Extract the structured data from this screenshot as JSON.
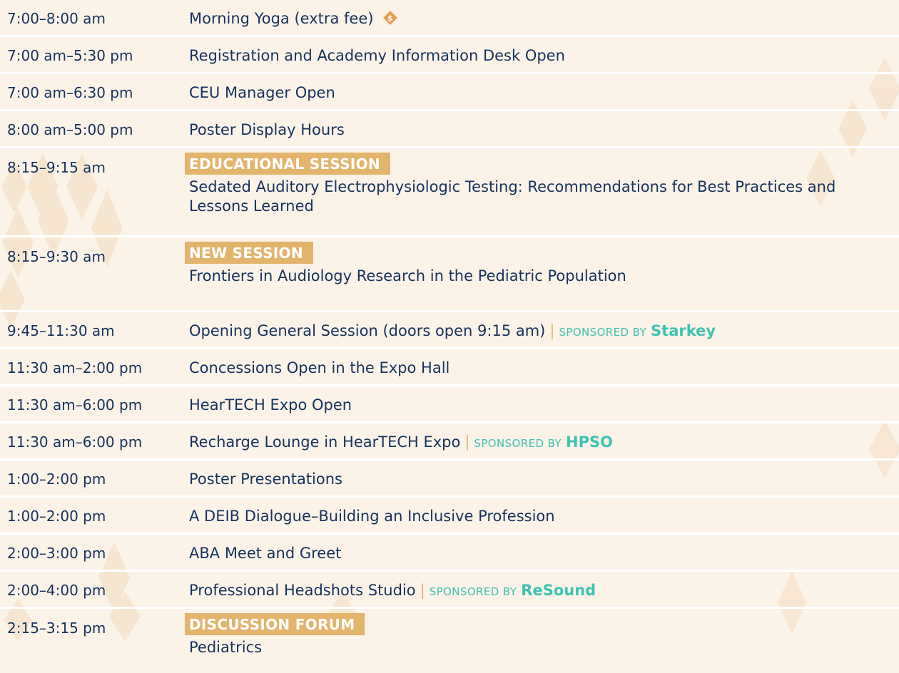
{
  "colors": {
    "background": "#fbf3e8",
    "text": "#16325c",
    "tag_background": "#e3b46c",
    "sponsor": "#3fc2b3",
    "divider": "#ffffff"
  },
  "icons": {
    "fee": "dollar-diamond-icon"
  },
  "rows": [
    {
      "time": "7:00–8:00 am",
      "title": "Morning Yoga (extra fee)"
    },
    {
      "time": "7:00 am–5:30 pm",
      "title": "Registration and Academy Information Desk Open"
    },
    {
      "time": "7:00 am–6:30 pm",
      "title": "CEU Manager Open"
    },
    {
      "time": "8:00 am–5:00 pm",
      "title": "Poster Display Hours"
    },
    {
      "time": "8:15–9:15 am",
      "tag": "EDUCATIONAL SESSION",
      "title": "Sedated Auditory Electrophysiologic Testing: Recommendations for Best Practices and Lessons Learned"
    },
    {
      "time": "8:15–9:30 am",
      "tag": "NEW SESSION",
      "title": "Frontiers in Audiology Research in the Pediatric Population"
    },
    {
      "time": "9:45–11:30 am",
      "title": "Opening General Session (doors open 9:15 am)",
      "sponsor_label": "SPONSORED BY",
      "sponsor": "Starkey"
    },
    {
      "time": "11:30 am–2:00 pm",
      "title": "Concessions Open in the Expo Hall"
    },
    {
      "time": "11:30 am–6:00 pm",
      "title": "HearTECH Expo Open"
    },
    {
      "time": "11:30 am–6:00 pm",
      "title": "Recharge Lounge in HearTECH Expo",
      "sponsor_label": "SPONSORED BY",
      "sponsor": "HPSO"
    },
    {
      "time": "1:00–2:00 pm",
      "title": "Poster Presentations"
    },
    {
      "time": "1:00–2:00 pm",
      "title": "A DEIB Dialogue–Building an Inclusive Profession"
    },
    {
      "time": "2:00–3:00 pm",
      "title": "ABA Meet and Greet"
    },
    {
      "time": "2:00–4:00 pm",
      "title": "Professional Headshots Studio",
      "sponsor_label": "SPONSORED BY",
      "sponsor": "ReSound"
    },
    {
      "time": "2:15–3:15 pm",
      "tag": "DISCUSSION FORUM",
      "title": "Pediatrics"
    }
  ]
}
